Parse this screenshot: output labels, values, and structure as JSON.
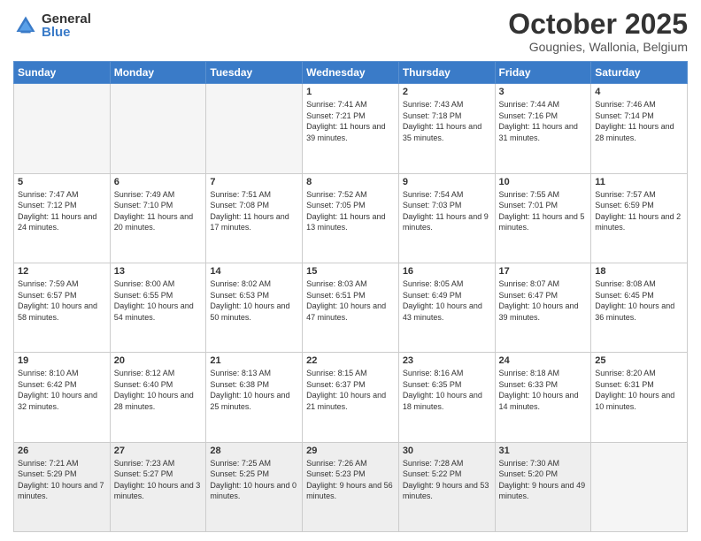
{
  "logo": {
    "general": "General",
    "blue": "Blue"
  },
  "header": {
    "month": "October 2025",
    "location": "Gougnies, Wallonia, Belgium"
  },
  "days_of_week": [
    "Sunday",
    "Monday",
    "Tuesday",
    "Wednesday",
    "Thursday",
    "Friday",
    "Saturday"
  ],
  "weeks": [
    [
      {
        "day": "",
        "sunrise": "",
        "sunset": "",
        "daylight": ""
      },
      {
        "day": "",
        "sunrise": "",
        "sunset": "",
        "daylight": ""
      },
      {
        "day": "",
        "sunrise": "",
        "sunset": "",
        "daylight": ""
      },
      {
        "day": "1",
        "sunrise": "Sunrise: 7:41 AM",
        "sunset": "Sunset: 7:21 PM",
        "daylight": "Daylight: 11 hours and 39 minutes."
      },
      {
        "day": "2",
        "sunrise": "Sunrise: 7:43 AM",
        "sunset": "Sunset: 7:18 PM",
        "daylight": "Daylight: 11 hours and 35 minutes."
      },
      {
        "day": "3",
        "sunrise": "Sunrise: 7:44 AM",
        "sunset": "Sunset: 7:16 PM",
        "daylight": "Daylight: 11 hours and 31 minutes."
      },
      {
        "day": "4",
        "sunrise": "Sunrise: 7:46 AM",
        "sunset": "Sunset: 7:14 PM",
        "daylight": "Daylight: 11 hours and 28 minutes."
      }
    ],
    [
      {
        "day": "5",
        "sunrise": "Sunrise: 7:47 AM",
        "sunset": "Sunset: 7:12 PM",
        "daylight": "Daylight: 11 hours and 24 minutes."
      },
      {
        "day": "6",
        "sunrise": "Sunrise: 7:49 AM",
        "sunset": "Sunset: 7:10 PM",
        "daylight": "Daylight: 11 hours and 20 minutes."
      },
      {
        "day": "7",
        "sunrise": "Sunrise: 7:51 AM",
        "sunset": "Sunset: 7:08 PM",
        "daylight": "Daylight: 11 hours and 17 minutes."
      },
      {
        "day": "8",
        "sunrise": "Sunrise: 7:52 AM",
        "sunset": "Sunset: 7:05 PM",
        "daylight": "Daylight: 11 hours and 13 minutes."
      },
      {
        "day": "9",
        "sunrise": "Sunrise: 7:54 AM",
        "sunset": "Sunset: 7:03 PM",
        "daylight": "Daylight: 11 hours and 9 minutes."
      },
      {
        "day": "10",
        "sunrise": "Sunrise: 7:55 AM",
        "sunset": "Sunset: 7:01 PM",
        "daylight": "Daylight: 11 hours and 5 minutes."
      },
      {
        "day": "11",
        "sunrise": "Sunrise: 7:57 AM",
        "sunset": "Sunset: 6:59 PM",
        "daylight": "Daylight: 11 hours and 2 minutes."
      }
    ],
    [
      {
        "day": "12",
        "sunrise": "Sunrise: 7:59 AM",
        "sunset": "Sunset: 6:57 PM",
        "daylight": "Daylight: 10 hours and 58 minutes."
      },
      {
        "day": "13",
        "sunrise": "Sunrise: 8:00 AM",
        "sunset": "Sunset: 6:55 PM",
        "daylight": "Daylight: 10 hours and 54 minutes."
      },
      {
        "day": "14",
        "sunrise": "Sunrise: 8:02 AM",
        "sunset": "Sunset: 6:53 PM",
        "daylight": "Daylight: 10 hours and 50 minutes."
      },
      {
        "day": "15",
        "sunrise": "Sunrise: 8:03 AM",
        "sunset": "Sunset: 6:51 PM",
        "daylight": "Daylight: 10 hours and 47 minutes."
      },
      {
        "day": "16",
        "sunrise": "Sunrise: 8:05 AM",
        "sunset": "Sunset: 6:49 PM",
        "daylight": "Daylight: 10 hours and 43 minutes."
      },
      {
        "day": "17",
        "sunrise": "Sunrise: 8:07 AM",
        "sunset": "Sunset: 6:47 PM",
        "daylight": "Daylight: 10 hours and 39 minutes."
      },
      {
        "day": "18",
        "sunrise": "Sunrise: 8:08 AM",
        "sunset": "Sunset: 6:45 PM",
        "daylight": "Daylight: 10 hours and 36 minutes."
      }
    ],
    [
      {
        "day": "19",
        "sunrise": "Sunrise: 8:10 AM",
        "sunset": "Sunset: 6:42 PM",
        "daylight": "Daylight: 10 hours and 32 minutes."
      },
      {
        "day": "20",
        "sunrise": "Sunrise: 8:12 AM",
        "sunset": "Sunset: 6:40 PM",
        "daylight": "Daylight: 10 hours and 28 minutes."
      },
      {
        "day": "21",
        "sunrise": "Sunrise: 8:13 AM",
        "sunset": "Sunset: 6:38 PM",
        "daylight": "Daylight: 10 hours and 25 minutes."
      },
      {
        "day": "22",
        "sunrise": "Sunrise: 8:15 AM",
        "sunset": "Sunset: 6:37 PM",
        "daylight": "Daylight: 10 hours and 21 minutes."
      },
      {
        "day": "23",
        "sunrise": "Sunrise: 8:16 AM",
        "sunset": "Sunset: 6:35 PM",
        "daylight": "Daylight: 10 hours and 18 minutes."
      },
      {
        "day": "24",
        "sunrise": "Sunrise: 8:18 AM",
        "sunset": "Sunset: 6:33 PM",
        "daylight": "Daylight: 10 hours and 14 minutes."
      },
      {
        "day": "25",
        "sunrise": "Sunrise: 8:20 AM",
        "sunset": "Sunset: 6:31 PM",
        "daylight": "Daylight: 10 hours and 10 minutes."
      }
    ],
    [
      {
        "day": "26",
        "sunrise": "Sunrise: 7:21 AM",
        "sunset": "Sunset: 5:29 PM",
        "daylight": "Daylight: 10 hours and 7 minutes."
      },
      {
        "day": "27",
        "sunrise": "Sunrise: 7:23 AM",
        "sunset": "Sunset: 5:27 PM",
        "daylight": "Daylight: 10 hours and 3 minutes."
      },
      {
        "day": "28",
        "sunrise": "Sunrise: 7:25 AM",
        "sunset": "Sunset: 5:25 PM",
        "daylight": "Daylight: 10 hours and 0 minutes."
      },
      {
        "day": "29",
        "sunrise": "Sunrise: 7:26 AM",
        "sunset": "Sunset: 5:23 PM",
        "daylight": "Daylight: 9 hours and 56 minutes."
      },
      {
        "day": "30",
        "sunrise": "Sunrise: 7:28 AM",
        "sunset": "Sunset: 5:22 PM",
        "daylight": "Daylight: 9 hours and 53 minutes."
      },
      {
        "day": "31",
        "sunrise": "Sunrise: 7:30 AM",
        "sunset": "Sunset: 5:20 PM",
        "daylight": "Daylight: 9 hours and 49 minutes."
      },
      {
        "day": "",
        "sunrise": "",
        "sunset": "",
        "daylight": ""
      }
    ]
  ]
}
